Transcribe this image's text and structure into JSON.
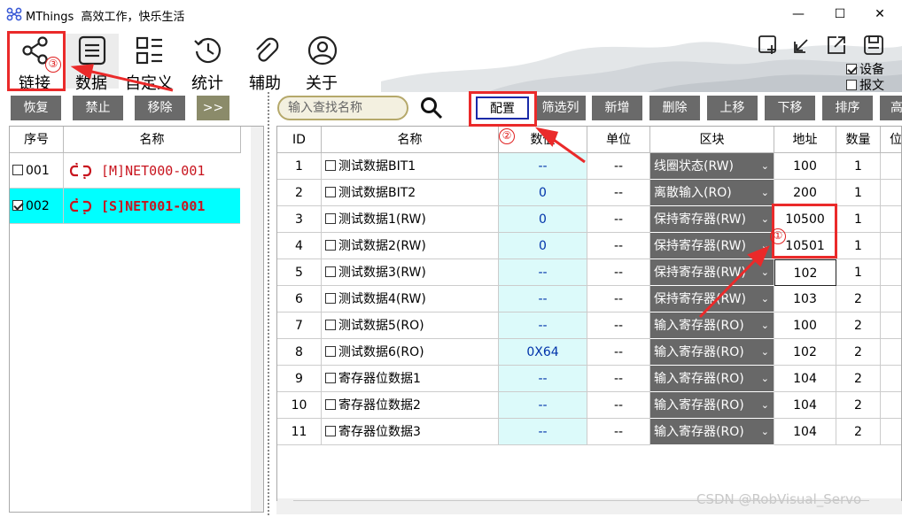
{
  "titlebar": {
    "app_name": "MThings",
    "subtitle": "高效工作，快乐生活",
    "minimize": "—",
    "maximize": "☐",
    "close": "✕"
  },
  "toolbar": {
    "items": [
      {
        "label": "链接",
        "icon": "share-icon"
      },
      {
        "label": "数据",
        "icon": "list-icon"
      },
      {
        "label": "自定义",
        "icon": "grid-icon"
      },
      {
        "label": "统计",
        "icon": "clock-icon"
      },
      {
        "label": "辅助",
        "icon": "paperclip-icon"
      },
      {
        "label": "关于",
        "icon": "user-icon"
      }
    ],
    "right_icons": [
      "add-window-icon",
      "shrink-icon",
      "expand-icon",
      "save-icon"
    ],
    "checkboxes": [
      {
        "label": "设备",
        "checked": true
      },
      {
        "label": "报文",
        "checked": false
      }
    ]
  },
  "left_buttons": [
    "恢复",
    "禁止",
    "移除",
    ">>"
  ],
  "left_table": {
    "headers": [
      "序号",
      "名称"
    ],
    "rows": [
      {
        "num": "001",
        "name": "[M]NET000-001",
        "checked": false,
        "selected": false
      },
      {
        "num": "002",
        "name": "[S]NET001-001",
        "checked": true,
        "selected": true
      }
    ]
  },
  "search": {
    "placeholder": "输入查找名称"
  },
  "actions": [
    "配置",
    "筛选列",
    "新增",
    "删除",
    "上移",
    "下移",
    "排序",
    "高"
  ],
  "grid": {
    "headers": [
      "ID",
      "名称",
      "数值",
      "单位",
      "区块",
      "地址",
      "数量",
      "位"
    ],
    "rows": [
      {
        "id": "1",
        "name": "测试数据BIT1",
        "value": "--",
        "unit": "--",
        "area": "线圈状态(RW)",
        "addr": "100",
        "qty": "1"
      },
      {
        "id": "2",
        "name": "测试数据BIT2",
        "value": "0",
        "unit": "--",
        "area": "离散输入(RO)",
        "addr": "200",
        "qty": "1"
      },
      {
        "id": "3",
        "name": "测试数据1(RW)",
        "value": "0",
        "unit": "--",
        "area": "保持寄存器(RW)",
        "addr": "10500",
        "qty": "1"
      },
      {
        "id": "4",
        "name": "测试数据2(RW)",
        "value": "0",
        "unit": "--",
        "area": "保持寄存器(RW)",
        "addr": "10501",
        "qty": "1"
      },
      {
        "id": "5",
        "name": "测试数据3(RW)",
        "value": "--",
        "unit": "--",
        "area": "保持寄存器(RW)",
        "addr": "102",
        "qty": "1"
      },
      {
        "id": "6",
        "name": "测试数据4(RW)",
        "value": "--",
        "unit": "--",
        "area": "保持寄存器(RW)",
        "addr": "103",
        "qty": "2"
      },
      {
        "id": "7",
        "name": "测试数据5(RO)",
        "value": "--",
        "unit": "--",
        "area": "输入寄存器(RO)",
        "addr": "100",
        "qty": "2"
      },
      {
        "id": "8",
        "name": "测试数据6(RO)",
        "value": "0X64",
        "unit": "--",
        "area": "输入寄存器(RO)",
        "addr": "102",
        "qty": "2"
      },
      {
        "id": "9",
        "name": "寄存器位数据1",
        "value": "--",
        "unit": "--",
        "area": "输入寄存器(RO)",
        "addr": "104",
        "qty": "2"
      },
      {
        "id": "10",
        "name": "寄存器位数据2",
        "value": "--",
        "unit": "--",
        "area": "输入寄存器(RO)",
        "addr": "104",
        "qty": "2"
      },
      {
        "id": "11",
        "name": "寄存器位数据3",
        "value": "--",
        "unit": "--",
        "area": "输入寄存器(RO)",
        "addr": "104",
        "qty": "2"
      }
    ]
  },
  "annotations": {
    "step1": "①",
    "step2": "②",
    "step3": "③"
  },
  "watermark": "CSDN @RobVisual_Servo",
  "colors": {
    "highlight_red": "#ea2a2a",
    "selected_row": "#00ffff",
    "value_cell": "#dcfafa",
    "area_cell": "#686868",
    "net_name": "#c8141e"
  }
}
